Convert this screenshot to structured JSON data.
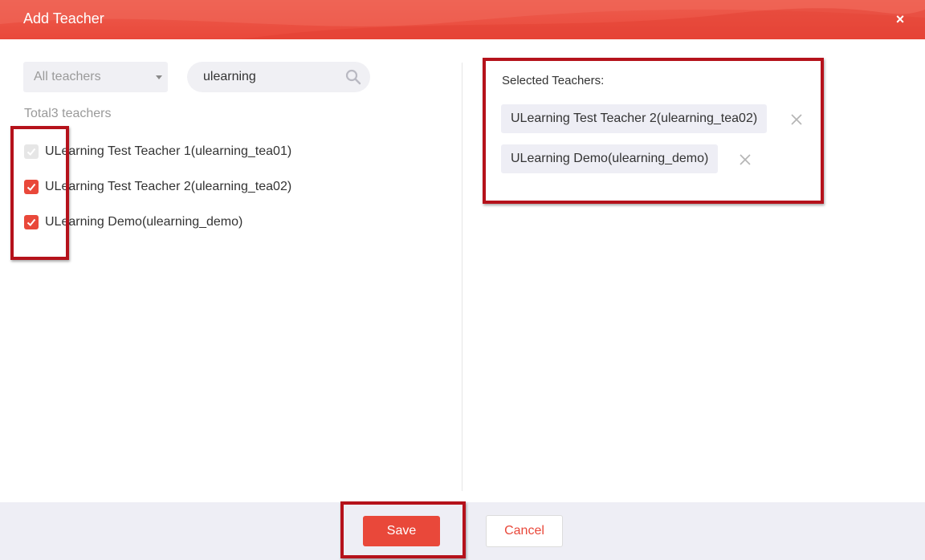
{
  "dialog": {
    "title": "Add Teacher",
    "close_label": "×"
  },
  "left": {
    "filter_select": {
      "value": "All teachers"
    },
    "search": {
      "value": "ulearning",
      "placeholder": ""
    },
    "total_text": "Total3 teachers",
    "teachers": [
      {
        "label": "ULearning Test Teacher 1(ulearning_tea01)",
        "state": "disabled"
      },
      {
        "label": "ULearning Test Teacher 2(ulearning_tea02)",
        "state": "checked"
      },
      {
        "label": "ULearning Demo(ulearning_demo)",
        "state": "checked"
      }
    ]
  },
  "right": {
    "title": "Selected Teachers:",
    "chips": [
      {
        "label": "ULearning Test Teacher 2(ulearning_tea02)"
      },
      {
        "label": "ULearning Demo(ulearning_demo)"
      }
    ]
  },
  "footer": {
    "save_label": "Save",
    "cancel_label": "Cancel"
  },
  "colors": {
    "accent": "#e9483a",
    "highlight": "#b5121b"
  }
}
